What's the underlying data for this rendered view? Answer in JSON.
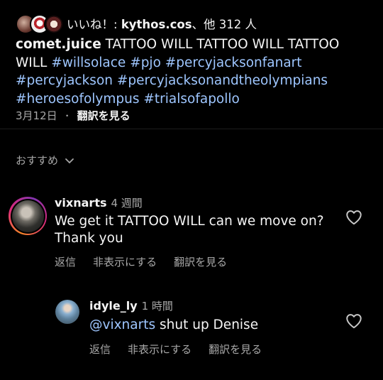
{
  "likes": {
    "prefix": "いいね！: ",
    "user": "kythos.cos",
    "suffix": "、他 312 人"
  },
  "caption": {
    "username": "comet.juice",
    "text": " TATTOO WILL TATTOO WILL TATTOO WILL ",
    "hashtags": [
      "#willsolace",
      "#pjo",
      "#percyjacksonfanart",
      "#percyjackson",
      "#percyjacksonandtheolympians",
      "#heroesofolympus",
      "#trialsofapollo"
    ]
  },
  "meta": {
    "date": "3月12日",
    "dot": "・",
    "translate": "翻訳を見る"
  },
  "recommended": {
    "label": "おすすめ"
  },
  "comments": [
    {
      "username": "vixnarts",
      "time": "4 週間",
      "text": "We get it TATTOO WILL can we move on? Thank you",
      "actions": [
        "返信",
        "非表示にする",
        "翻訳を見る"
      ]
    }
  ],
  "reply": {
    "username": "idyle_ly",
    "time": "1 時間",
    "mention": "@vixnarts",
    "text": " shut up Denise",
    "actions": [
      "返信",
      "非表示にする",
      "翻訳を見る"
    ]
  },
  "icons": {
    "heart": "heart-outline-icon",
    "chevron": "chevron-down-icon"
  },
  "colors": {
    "background": "#000000",
    "link": "#9ec6ff",
    "secondary": "#a8a8a8"
  }
}
